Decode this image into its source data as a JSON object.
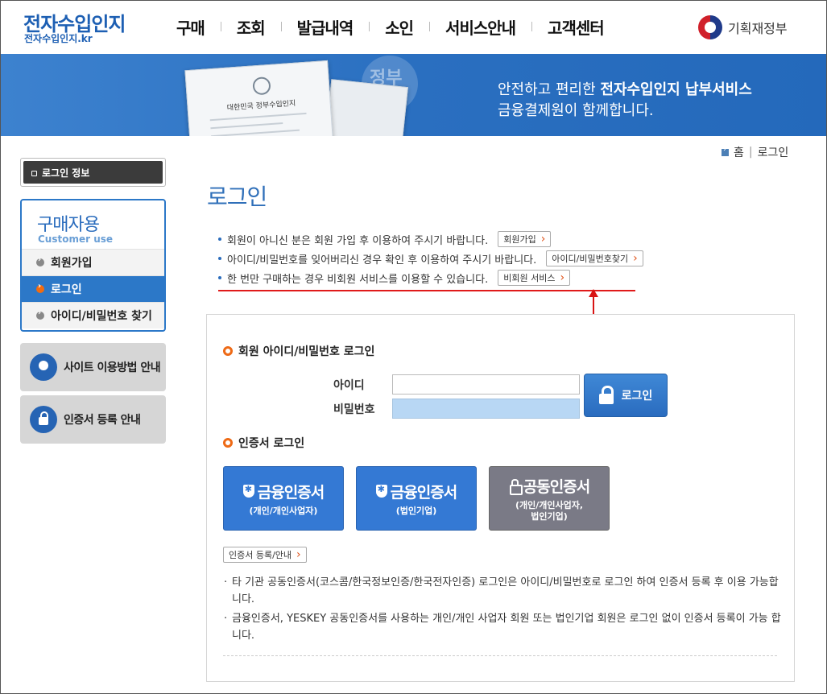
{
  "header": {
    "logo_main": "전자수입인지",
    "logo_sub": "전자수입인지.kr",
    "nav": [
      "구매",
      "조회",
      "발급내역",
      "소인",
      "서비스안내",
      "고객센터"
    ],
    "gov_name": "기획재정부"
  },
  "banner": {
    "line1_prefix": "안전하고 편리한 ",
    "line1_bold": "전자수입인지 납부서비스",
    "line2": "금융결제원이 함께합니다.",
    "doc_title": "대한민국 정부수입인지",
    "stamp_text": "정부"
  },
  "sidebar": {
    "login_info": "로그인 정보",
    "title": "구매자용",
    "subtitle": "Customer use",
    "items": [
      {
        "label": "회원가입",
        "active": false
      },
      {
        "label": "로그인",
        "active": true
      },
      {
        "label": "아이디/비밀번호 찾기",
        "active": false
      }
    ],
    "guide_site": "사이트 이용방법 안내",
    "guide_cert": "인증서 등록 안내"
  },
  "breadcrumb": {
    "home": "홈",
    "current": "로그인"
  },
  "page_title": "로그인",
  "info": [
    {
      "text": "회원이 아니신 분은 회원 가입 후 이용하여 주시기 바랍니다.",
      "button": "회원가입"
    },
    {
      "text": "아이디/비밀번호를 잊어버리신 경우 확인 후 이용하여 주시기 바랍니다.",
      "button": "아이디/비밀번호찾기"
    },
    {
      "text": "한 번만 구매하는 경우 비회원 서비스를 이용할 수 있습니다.",
      "button": "비회원 서비스"
    }
  ],
  "member_login": {
    "title": "회원 아이디/비밀번호 로그인",
    "id_label": "아이디",
    "pw_label": "비밀번호",
    "id_value": "",
    "pw_value": "",
    "login_button": "로그인"
  },
  "cert_login": {
    "title": "인증서 로그인",
    "buttons": [
      {
        "main": "금융인증서",
        "sub": "(개인/개인사업자)"
      },
      {
        "main": "금융인증서",
        "sub": "(법인기업)"
      },
      {
        "main": "공동인증서",
        "sub": "(개인/개인사업자,",
        "sub2": "법인기업)"
      }
    ],
    "register_button": "인증서 등록/안내",
    "notes": [
      "타 기관 공동인증서(코스콤/한국정보인증/한국전자인증) 로그인은 아이디/비밀번호로 로그인 하여 인증서 등록 후 이용 가능합니다.",
      "금융인증서, YESKEY 공동인증서를 사용하는 개인/개인 사업자 회원 또는 법인기업 회원은 로그인 없이 인증서 등록이 가능 합니다."
    ]
  },
  "colors": {
    "primary": "#2c78c8",
    "accent": "#ee6a16",
    "highlight_line": "#e01a1a"
  }
}
